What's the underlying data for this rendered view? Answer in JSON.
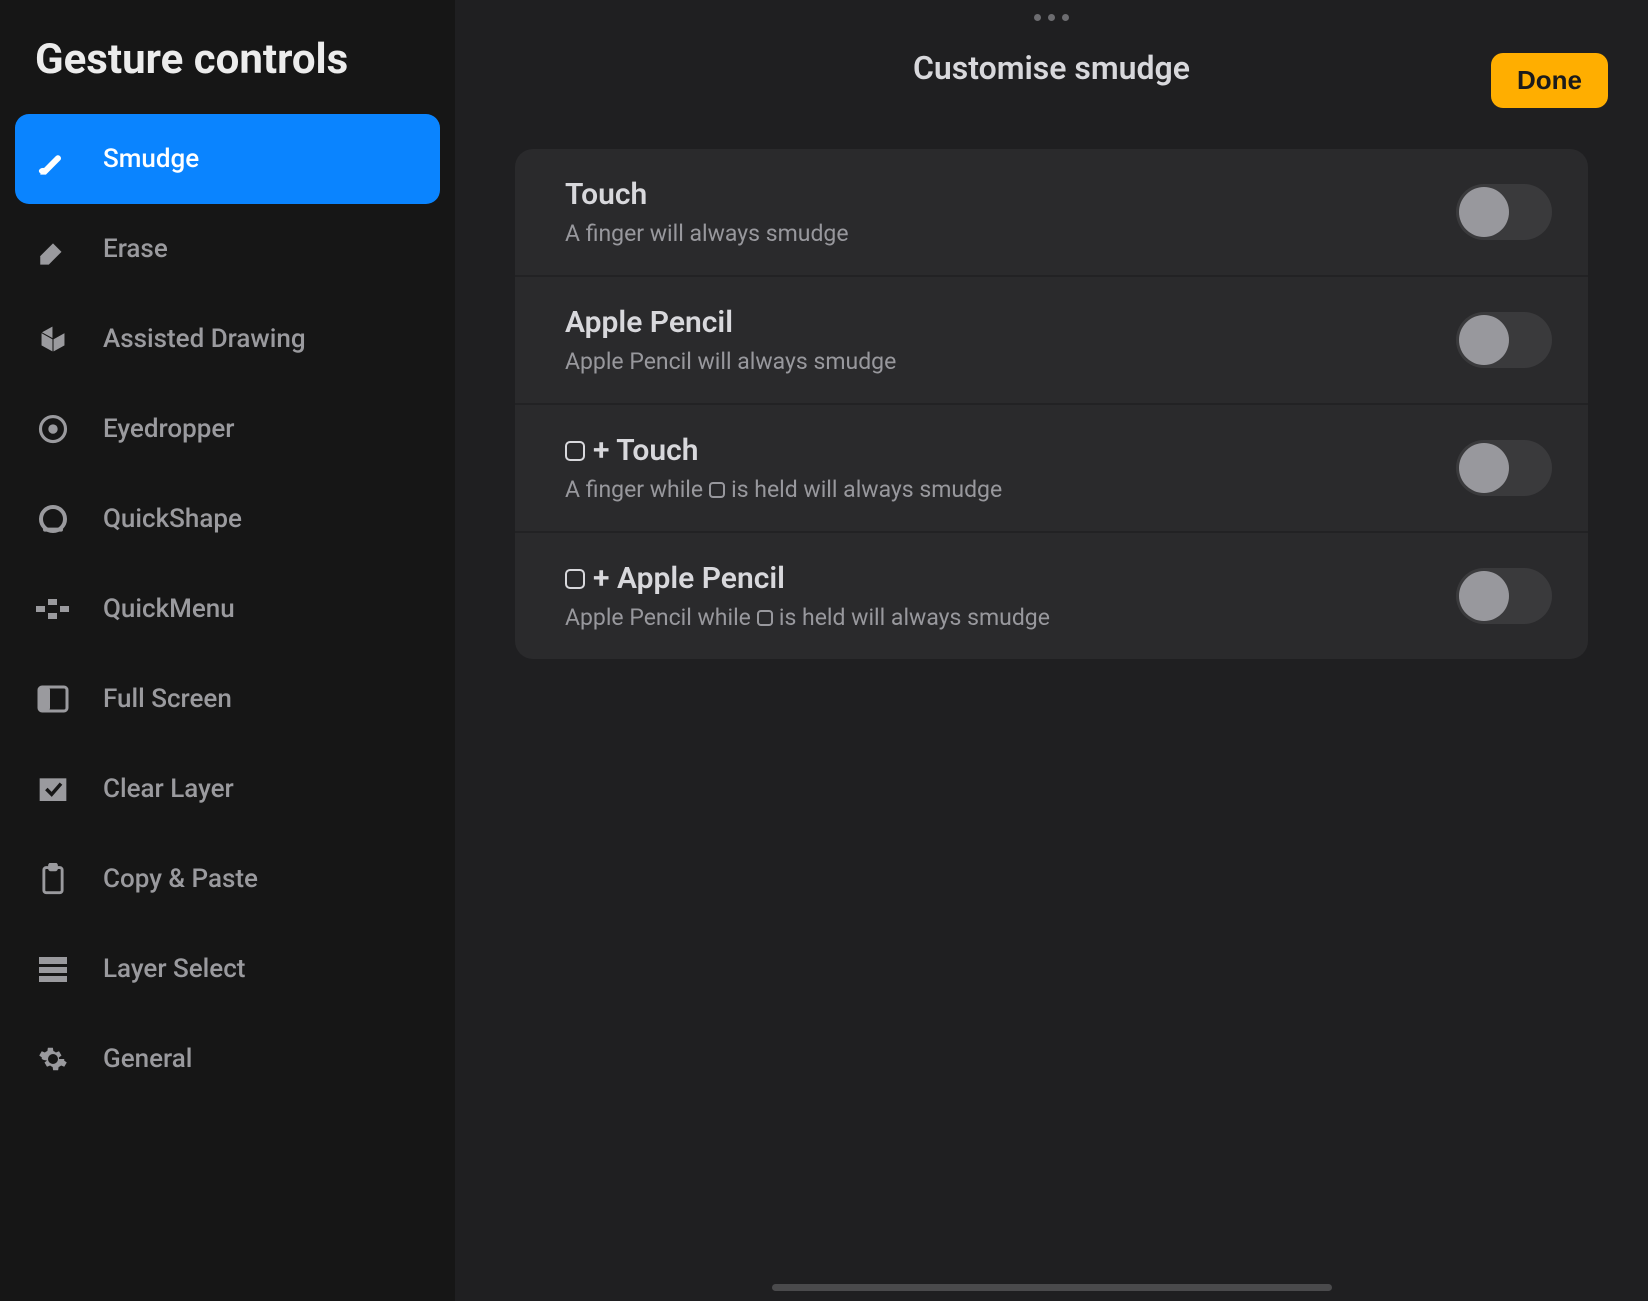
{
  "sidebar": {
    "title": "Gesture controls",
    "items": [
      {
        "label": "Smudge",
        "selected": true
      },
      {
        "label": "Erase",
        "selected": false
      },
      {
        "label": "Assisted Drawing",
        "selected": false
      },
      {
        "label": "Eyedropper",
        "selected": false
      },
      {
        "label": "QuickShape",
        "selected": false
      },
      {
        "label": "QuickMenu",
        "selected": false
      },
      {
        "label": "Full Screen",
        "selected": false
      },
      {
        "label": "Clear Layer",
        "selected": false
      },
      {
        "label": "Copy & Paste",
        "selected": false
      },
      {
        "label": "Layer Select",
        "selected": false
      },
      {
        "label": "General",
        "selected": false
      }
    ]
  },
  "header": {
    "title": "Customise smudge",
    "done_label": "Done"
  },
  "rows": [
    {
      "title_before": "Touch",
      "title_mod": false,
      "title_after": "",
      "sub_before": "A finger will always smudge",
      "sub_mod": false,
      "sub_after": "",
      "on": false
    },
    {
      "title_before": "Apple Pencil",
      "title_mod": false,
      "title_after": "",
      "sub_before": "Apple Pencil will always smudge",
      "sub_mod": false,
      "sub_after": "",
      "on": false
    },
    {
      "title_before": "",
      "title_mod": true,
      "title_after": "+ Touch",
      "sub_before": "A finger while",
      "sub_mod": true,
      "sub_after": "is held will always smudge",
      "on": false
    },
    {
      "title_before": "",
      "title_mod": true,
      "title_after": "+ Apple Pencil",
      "sub_before": "Apple Pencil while",
      "sub_mod": true,
      "sub_after": "is held will always smudge",
      "on": false
    }
  ]
}
